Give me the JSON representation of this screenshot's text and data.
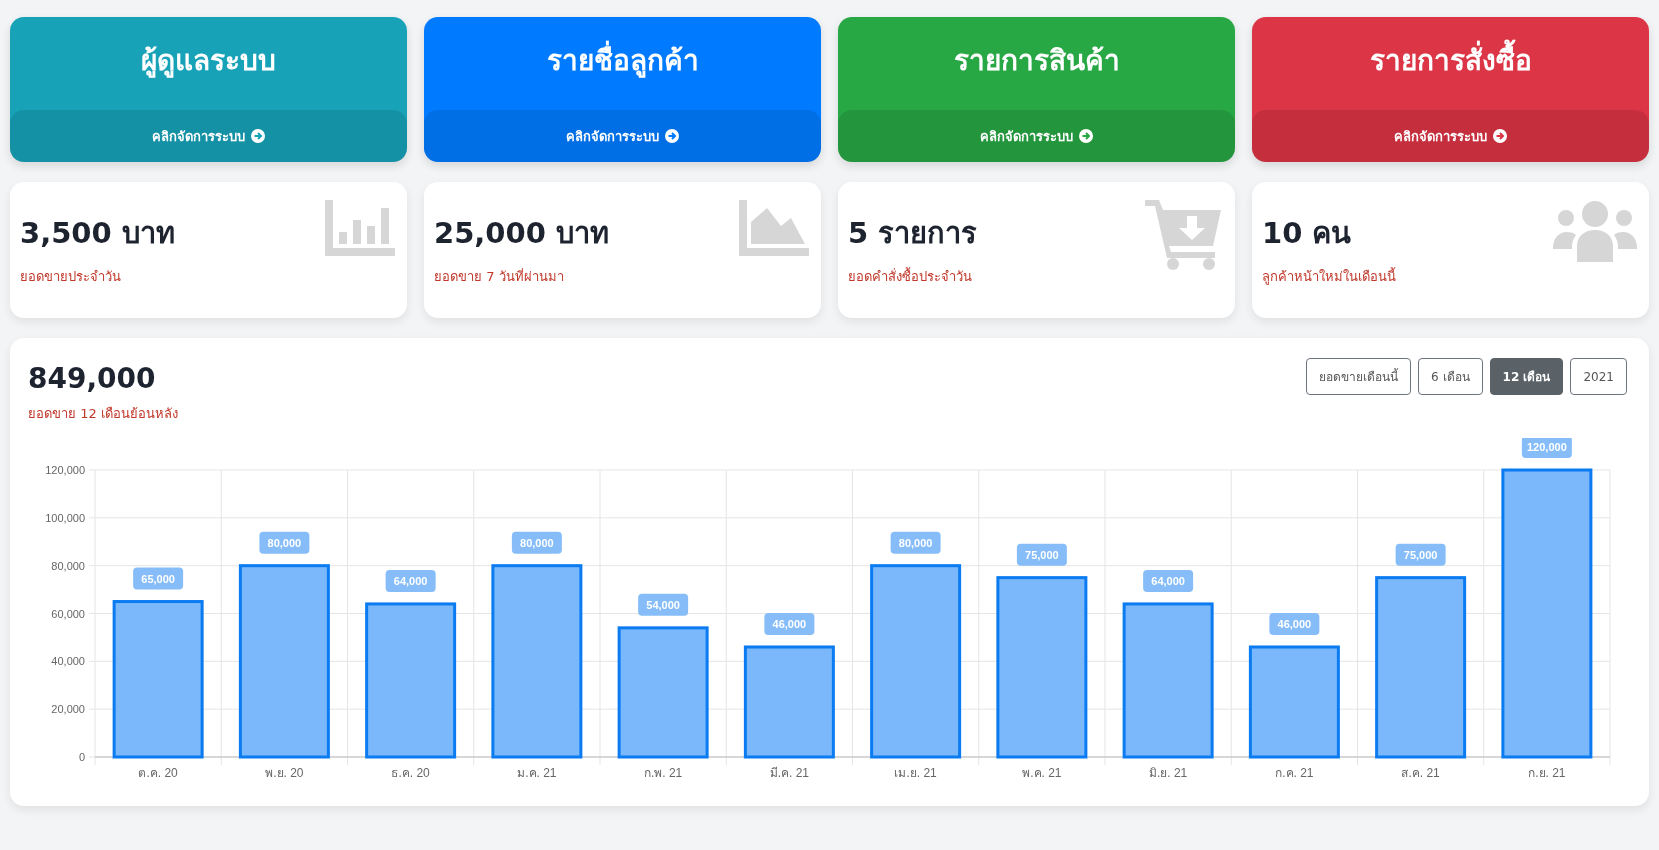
{
  "menu_cards": [
    {
      "title": "ผู้ดูแลระบบ",
      "link": "คลิกจัดการระบบ",
      "color": "#17a2b8"
    },
    {
      "title": "รายชื่อลูกค้า",
      "link": "คลิกจัดการระบบ",
      "color": "#007bff"
    },
    {
      "title": "รายการสินค้า",
      "link": "คลิกจัดการระบบ",
      "color": "#28a745"
    },
    {
      "title": "รายการสั่งซื้อ",
      "link": "คลิกจัดการระบบ",
      "color": "#dc3545"
    }
  ],
  "stat_cards": [
    {
      "value": "3,500 บาท",
      "caption": "ยอดขายประจำวัน",
      "kind": "bar"
    },
    {
      "value": "25,000 บาท",
      "caption": "ยอดขาย 7 วันที่ผ่านมา",
      "kind": "area"
    },
    {
      "value": "5 รายการ",
      "caption": "ยอดคำสั่งซื้อประจำวัน",
      "kind": "cart"
    },
    {
      "value": "10 คน",
      "caption": "ลูกค้าหน้าใหม่ในเดือนนี้",
      "kind": "users"
    }
  ],
  "sales_panel": {
    "total": "849,000",
    "caption": "ยอดขาย 12 เดือนย้อนหลัง",
    "periods": [
      {
        "label": "ยอดขายเดือนนี้",
        "selected": false
      },
      {
        "label": "6 เดือน",
        "selected": false
      },
      {
        "label": "12 เดือน",
        "selected": true
      },
      {
        "label": "2021",
        "selected": false
      }
    ],
    "chart_data": {
      "type": "bar",
      "categories": [
        "ต.ค. 20",
        "พ.ย. 20",
        "ธ.ค. 20",
        "ม.ค. 21",
        "ก.พ. 21",
        "มี.ค. 21",
        "เม.ย. 21",
        "พ.ค. 21",
        "มิ.ย. 21",
        "ก.ค. 21",
        "ส.ค. 21",
        "ก.ย. 21"
      ],
      "grid": true,
      "series": [
        {
          "color": "#7ab8fb",
          "values": [
            65000,
            80000,
            64000,
            80000,
            54000,
            46000,
            80000,
            75000,
            64000,
            46000,
            75000,
            120000
          ]
        }
      ],
      "ylim": [
        0,
        120000
      ],
      "yticks": [
        {
          "value": 0,
          "label": "0"
        },
        {
          "value": 20000,
          "label": "20,000"
        },
        {
          "value": 40000,
          "label": "40,000"
        },
        {
          "value": 60000,
          "label": "60,000"
        },
        {
          "value": 80000,
          "label": "80,000"
        },
        {
          "value": 100000,
          "label": "100,000"
        },
        {
          "value": 120000,
          "label": "120,000"
        }
      ],
      "value_labels": [
        "65,000",
        "80,000",
        "64,000",
        "80,000",
        "54,000",
        "46,000",
        "80,000",
        "75,000",
        "64,000",
        "46,000",
        "75,000",
        "120,000"
      ]
    }
  }
}
